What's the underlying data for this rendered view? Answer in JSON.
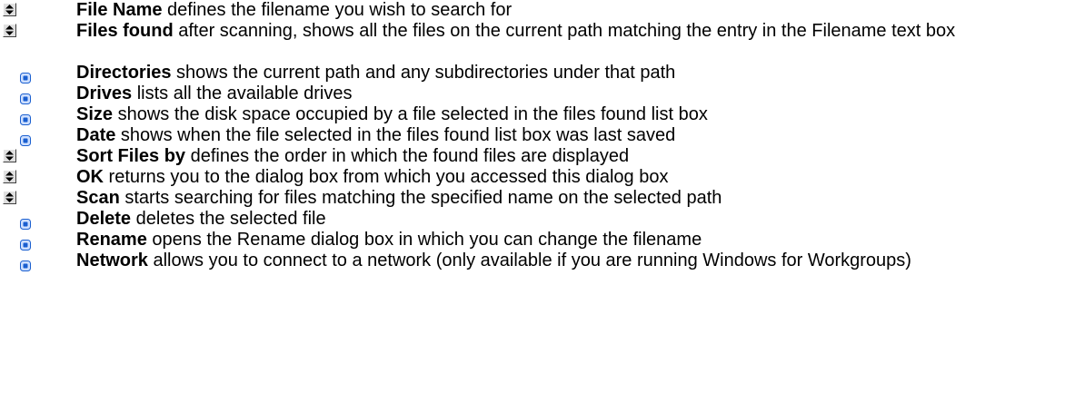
{
  "items": [
    {
      "icon": "spin-icon",
      "term": "File Name",
      "text": " defines the filename you wish to search for"
    },
    {
      "icon": "spin-icon",
      "term": "Files found",
      "text": " after scanning, shows all the files on the current path matching the entry in the Filename text box"
    },
    {
      "icon": "bullet-icon",
      "term": "Directories",
      "text": " shows the current path and any subdirectories under that path"
    },
    {
      "icon": "bullet-icon",
      "term": "Drives",
      "text": " lists all the available drives"
    },
    {
      "icon": "bullet-icon",
      "term": "Size",
      "text": " shows the disk space occupied by a file selected in the files found list box"
    },
    {
      "icon": "bullet-icon",
      "term": "Date",
      "text": " shows when the file selected in the files found list box was last saved"
    },
    {
      "icon": "spin-icon",
      "term": "Sort Files by",
      "text": " defines the order in which the found files are displayed"
    },
    {
      "icon": "spin-icon",
      "term": "OK",
      "text": " returns you to the dialog box from which you accessed this dialog box"
    },
    {
      "icon": "spin-icon",
      "term": "Scan",
      "text": " starts searching for files matching the specified name on the selected path"
    },
    {
      "icon": "bullet-icon",
      "term": "Delete",
      "text": " deletes the selected file"
    },
    {
      "icon": "bullet-icon",
      "term": "Rename",
      "text": " opens the Rename dialog box in which you can change the filename"
    },
    {
      "icon": "bullet-icon",
      "term": "Network",
      "text": " allows you to connect to a network (only available if you are running Windows for Workgroups)"
    }
  ],
  "colors": {
    "text": "#000000",
    "bullet_blue": "#1a5fd0",
    "bullet_light": "#cfe0ff",
    "spin_face": "#e0e0e0"
  }
}
